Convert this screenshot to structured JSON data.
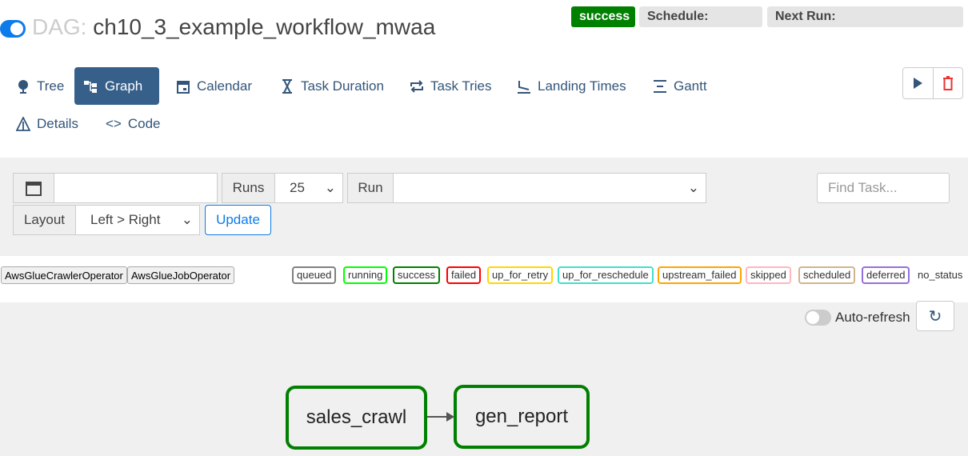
{
  "header": {
    "dag_prefix": "DAG:",
    "dag_id": "ch10_3_example_workflow_mwaa",
    "paused": false,
    "status": "success",
    "schedule_label": "Schedule:",
    "next_run_label": "Next Run:"
  },
  "nav": {
    "tabs": [
      {
        "label": "Tree",
        "icon": "tree-icon"
      },
      {
        "label": "Graph",
        "icon": "graph-icon",
        "active": true
      },
      {
        "label": "Calendar",
        "icon": "calendar-icon"
      },
      {
        "label": "Task Duration",
        "icon": "hourglass-icon"
      },
      {
        "label": "Task Tries",
        "icon": "repeat-icon"
      },
      {
        "label": "Landing Times",
        "icon": "plane-landing-icon"
      },
      {
        "label": "Gantt",
        "icon": "gantt-icon"
      },
      {
        "label": "Details",
        "icon": "warning-triangle-icon"
      },
      {
        "label": "Code",
        "icon": "code-icon"
      }
    ]
  },
  "controls": {
    "date_value": "",
    "runs_label": "Runs",
    "runs_value": "25",
    "run_label": "Run",
    "run_value": "",
    "find_placeholder": "Find Task...",
    "layout_label": "Layout",
    "layout_value": "Left > Right",
    "update_label": "Update"
  },
  "operators": [
    "AwsGlueCrawlerOperator",
    "AwsGlueJobOperator"
  ],
  "legend": [
    {
      "label": "queued",
      "color": "#808080"
    },
    {
      "label": "running",
      "color": "#00ff00"
    },
    {
      "label": "success",
      "color": "#008000"
    },
    {
      "label": "failed",
      "color": "#ff0000"
    },
    {
      "label": "up_for_retry",
      "color": "#ffd700"
    },
    {
      "label": "up_for_reschedule",
      "color": "#40e0d0"
    },
    {
      "label": "upstream_failed",
      "color": "#ffa500"
    },
    {
      "label": "skipped",
      "color": "#ffb6c1"
    },
    {
      "label": "scheduled",
      "color": "#d2b48c"
    },
    {
      "label": "deferred",
      "color": "#9370db"
    },
    {
      "label": "no_status",
      "color": ""
    }
  ],
  "graph": {
    "auto_refresh_label": "Auto-refresh",
    "auto_refresh": false,
    "nodes": [
      {
        "id": "sales_crawl",
        "state": "success"
      },
      {
        "id": "gen_report",
        "state": "success"
      }
    ],
    "edges": [
      [
        "sales_crawl",
        "gen_report"
      ]
    ]
  }
}
